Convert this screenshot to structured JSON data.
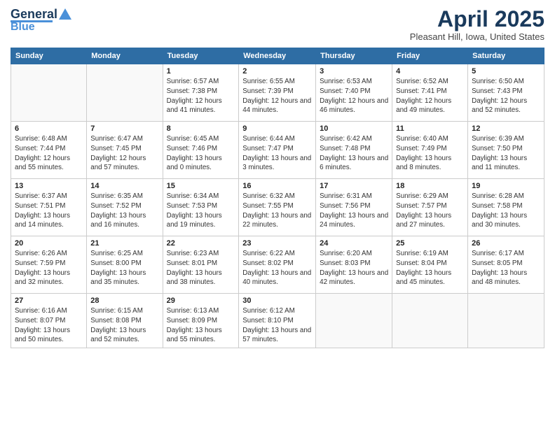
{
  "header": {
    "logo_line1": "General",
    "logo_line2": "Blue",
    "title": "April 2025",
    "subtitle": "Pleasant Hill, Iowa, United States"
  },
  "weekdays": [
    "Sunday",
    "Monday",
    "Tuesday",
    "Wednesday",
    "Thursday",
    "Friday",
    "Saturday"
  ],
  "weeks": [
    [
      {
        "day": "",
        "info": ""
      },
      {
        "day": "",
        "info": ""
      },
      {
        "day": "1",
        "info": "Sunrise: 6:57 AM\nSunset: 7:38 PM\nDaylight: 12 hours and 41 minutes."
      },
      {
        "day": "2",
        "info": "Sunrise: 6:55 AM\nSunset: 7:39 PM\nDaylight: 12 hours and 44 minutes."
      },
      {
        "day": "3",
        "info": "Sunrise: 6:53 AM\nSunset: 7:40 PM\nDaylight: 12 hours and 46 minutes."
      },
      {
        "day": "4",
        "info": "Sunrise: 6:52 AM\nSunset: 7:41 PM\nDaylight: 12 hours and 49 minutes."
      },
      {
        "day": "5",
        "info": "Sunrise: 6:50 AM\nSunset: 7:43 PM\nDaylight: 12 hours and 52 minutes."
      }
    ],
    [
      {
        "day": "6",
        "info": "Sunrise: 6:48 AM\nSunset: 7:44 PM\nDaylight: 12 hours and 55 minutes."
      },
      {
        "day": "7",
        "info": "Sunrise: 6:47 AM\nSunset: 7:45 PM\nDaylight: 12 hours and 57 minutes."
      },
      {
        "day": "8",
        "info": "Sunrise: 6:45 AM\nSunset: 7:46 PM\nDaylight: 13 hours and 0 minutes."
      },
      {
        "day": "9",
        "info": "Sunrise: 6:44 AM\nSunset: 7:47 PM\nDaylight: 13 hours and 3 minutes."
      },
      {
        "day": "10",
        "info": "Sunrise: 6:42 AM\nSunset: 7:48 PM\nDaylight: 13 hours and 6 minutes."
      },
      {
        "day": "11",
        "info": "Sunrise: 6:40 AM\nSunset: 7:49 PM\nDaylight: 13 hours and 8 minutes."
      },
      {
        "day": "12",
        "info": "Sunrise: 6:39 AM\nSunset: 7:50 PM\nDaylight: 13 hours and 11 minutes."
      }
    ],
    [
      {
        "day": "13",
        "info": "Sunrise: 6:37 AM\nSunset: 7:51 PM\nDaylight: 13 hours and 14 minutes."
      },
      {
        "day": "14",
        "info": "Sunrise: 6:35 AM\nSunset: 7:52 PM\nDaylight: 13 hours and 16 minutes."
      },
      {
        "day": "15",
        "info": "Sunrise: 6:34 AM\nSunset: 7:53 PM\nDaylight: 13 hours and 19 minutes."
      },
      {
        "day": "16",
        "info": "Sunrise: 6:32 AM\nSunset: 7:55 PM\nDaylight: 13 hours and 22 minutes."
      },
      {
        "day": "17",
        "info": "Sunrise: 6:31 AM\nSunset: 7:56 PM\nDaylight: 13 hours and 24 minutes."
      },
      {
        "day": "18",
        "info": "Sunrise: 6:29 AM\nSunset: 7:57 PM\nDaylight: 13 hours and 27 minutes."
      },
      {
        "day": "19",
        "info": "Sunrise: 6:28 AM\nSunset: 7:58 PM\nDaylight: 13 hours and 30 minutes."
      }
    ],
    [
      {
        "day": "20",
        "info": "Sunrise: 6:26 AM\nSunset: 7:59 PM\nDaylight: 13 hours and 32 minutes."
      },
      {
        "day": "21",
        "info": "Sunrise: 6:25 AM\nSunset: 8:00 PM\nDaylight: 13 hours and 35 minutes."
      },
      {
        "day": "22",
        "info": "Sunrise: 6:23 AM\nSunset: 8:01 PM\nDaylight: 13 hours and 38 minutes."
      },
      {
        "day": "23",
        "info": "Sunrise: 6:22 AM\nSunset: 8:02 PM\nDaylight: 13 hours and 40 minutes."
      },
      {
        "day": "24",
        "info": "Sunrise: 6:20 AM\nSunset: 8:03 PM\nDaylight: 13 hours and 42 minutes."
      },
      {
        "day": "25",
        "info": "Sunrise: 6:19 AM\nSunset: 8:04 PM\nDaylight: 13 hours and 45 minutes."
      },
      {
        "day": "26",
        "info": "Sunrise: 6:17 AM\nSunset: 8:05 PM\nDaylight: 13 hours and 48 minutes."
      }
    ],
    [
      {
        "day": "27",
        "info": "Sunrise: 6:16 AM\nSunset: 8:07 PM\nDaylight: 13 hours and 50 minutes."
      },
      {
        "day": "28",
        "info": "Sunrise: 6:15 AM\nSunset: 8:08 PM\nDaylight: 13 hours and 52 minutes."
      },
      {
        "day": "29",
        "info": "Sunrise: 6:13 AM\nSunset: 8:09 PM\nDaylight: 13 hours and 55 minutes."
      },
      {
        "day": "30",
        "info": "Sunrise: 6:12 AM\nSunset: 8:10 PM\nDaylight: 13 hours and 57 minutes."
      },
      {
        "day": "",
        "info": ""
      },
      {
        "day": "",
        "info": ""
      },
      {
        "day": "",
        "info": ""
      }
    ]
  ]
}
